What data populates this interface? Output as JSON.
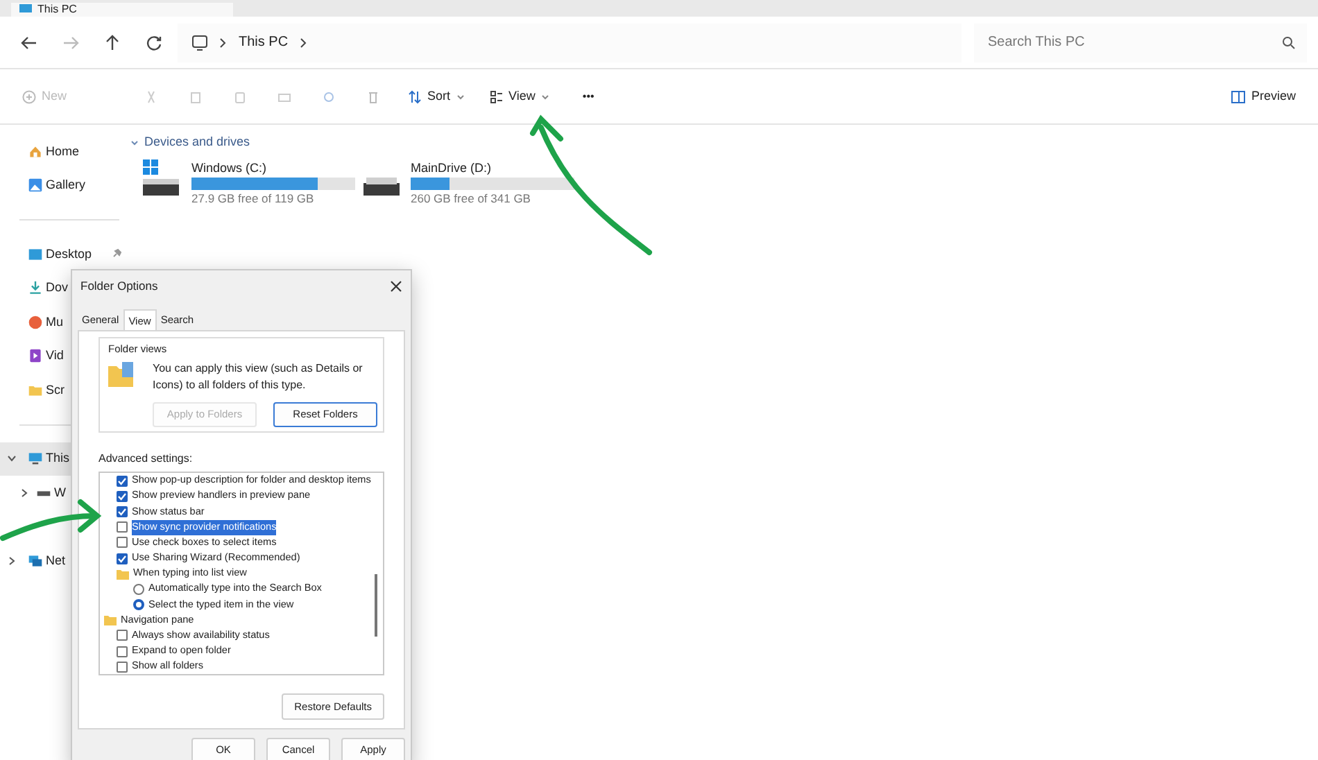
{
  "tab": {
    "title": "This PC"
  },
  "address": {
    "path": [
      "This PC"
    ]
  },
  "search": {
    "placeholder": "Search This PC"
  },
  "toolbar": {
    "new": {
      "label": "New",
      "disabled": true
    },
    "sort": {
      "label": "Sort"
    },
    "view": {
      "label": "View"
    },
    "more": {
      "label": "•••"
    },
    "preview": {
      "label": "Preview"
    }
  },
  "sidebar": {
    "items": [
      {
        "kind": "item",
        "label": "Home",
        "selected": false,
        "pinned": false
      },
      {
        "kind": "item",
        "label": "Gallery",
        "selected": false,
        "pinned": false
      },
      {
        "kind": "divider"
      },
      {
        "kind": "item",
        "label": "Desktop",
        "selected": false,
        "pinned": true
      },
      {
        "kind": "item",
        "label": "Dov",
        "selected": false,
        "pinned": false
      },
      {
        "kind": "item",
        "label": "Mu",
        "selected": false,
        "pinned": false
      },
      {
        "kind": "item",
        "label": "Vid",
        "selected": false,
        "pinned": false
      },
      {
        "kind": "item",
        "label": "Scr",
        "selected": false,
        "pinned": false
      },
      {
        "kind": "divider"
      },
      {
        "kind": "tree",
        "label": "This",
        "selected": true,
        "expanded": true,
        "children": [
          {
            "kind": "tree",
            "label": "W",
            "selected": false,
            "expanded": false
          }
        ]
      },
      {
        "kind": "spacer"
      },
      {
        "kind": "tree",
        "label": "Net",
        "selected": false,
        "expanded": false
      }
    ]
  },
  "content": {
    "section": "Devices and drives",
    "drives": [
      {
        "kind": "system",
        "name": "Windows (C:)",
        "level": 0.77,
        "reading": "27.9 GB free of 119 GB"
      },
      {
        "kind": "data",
        "name": "MainDrive (D:)",
        "level": 0.24,
        "reading": "260 GB free of 341 GB"
      }
    ]
  },
  "dialog": {
    "title": "Folder Options",
    "tabs": [
      {
        "label": "General",
        "selected": false
      },
      {
        "label": "View",
        "selected": true
      },
      {
        "label": "Search",
        "selected": false
      }
    ],
    "folder_views": {
      "title": "Folder views",
      "text": "You can apply this view (such as Details or Icons) to all folders of this type.",
      "buttons": [
        {
          "label": "Apply to Folders",
          "disabled": true
        },
        {
          "label": "Reset Folders",
          "disabled": false
        }
      ]
    },
    "advanced_label": "Advanced settings:",
    "advanced_settings": [
      {
        "kind": "checkbox",
        "label": "Show pop-up description for folder and desktop items",
        "checked": true,
        "selected": false
      },
      {
        "kind": "checkbox",
        "label": "Show preview handlers in preview pane",
        "checked": true,
        "selected": false
      },
      {
        "kind": "checkbox",
        "label": "Show status bar",
        "checked": true,
        "selected": false
      },
      {
        "kind": "checkbox",
        "label": "Show sync provider notifications",
        "checked": false,
        "selected": true
      },
      {
        "kind": "checkbox",
        "label": "Use check boxes to select items",
        "checked": false,
        "selected": false
      },
      {
        "kind": "checkbox",
        "label": "Use Sharing Wizard (Recommended)",
        "checked": true,
        "selected": false
      },
      {
        "kind": "group",
        "label": "When typing into list view",
        "children": [
          {
            "kind": "radio",
            "label": "Automatically type into the Search Box",
            "checked": false,
            "selected": false
          },
          {
            "kind": "radio",
            "label": "Select the typed item in the view",
            "checked": true,
            "selected": false
          }
        ]
      },
      {
        "kind": "section",
        "label": "Navigation pane",
        "children": [
          {
            "kind": "checkbox",
            "label": "Always show availability status",
            "checked": false,
            "selected": false
          },
          {
            "kind": "checkbox",
            "label": "Expand to open folder",
            "checked": false,
            "selected": false
          },
          {
            "kind": "checkbox",
            "label": "Show all folders",
            "checked": false,
            "selected": false
          }
        ]
      }
    ],
    "restore": "Restore Defaults",
    "buttons": [
      "OK",
      "Cancel",
      "Apply"
    ]
  }
}
